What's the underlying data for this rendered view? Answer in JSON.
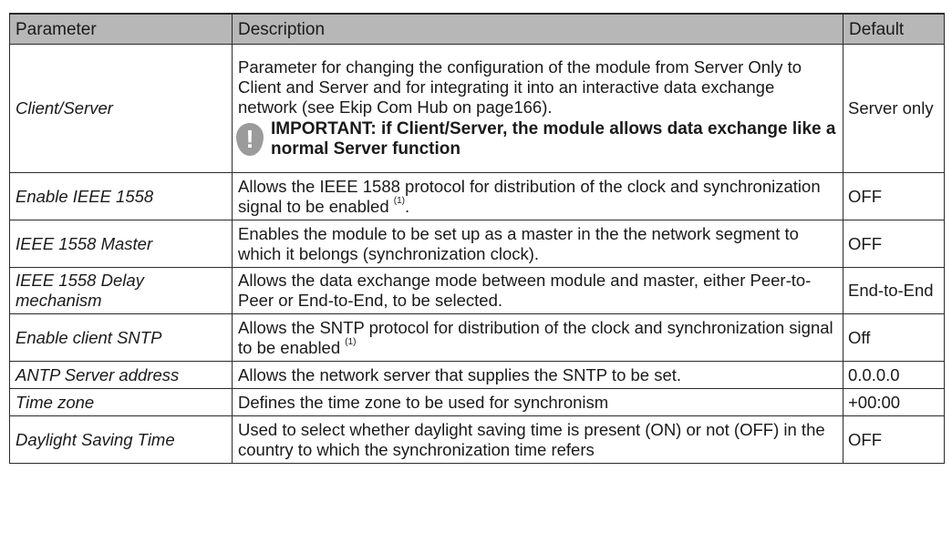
{
  "table": {
    "headers": [
      "Parameter",
      "Description",
      "Default"
    ],
    "rows": [
      {
        "parameter": "Client/Server",
        "description": "Parameter for changing the configuration of the module from Server Only to Client and Server and for integrating it into an interactive data exchange network (see Ekip Com Hub on page166).",
        "important": "IMPORTANT: if Client/Server, the module allows data exchange like a normal Server function",
        "default": "Server only"
      },
      {
        "parameter": "Enable IEEE 1558",
        "description": "Allows the IEEE 1588 protocol for distribution of the clock and synchronization signal to be enabled",
        "footnote": "(1)",
        "trail": ".",
        "default": "OFF"
      },
      {
        "parameter": "IEEE 1558 Master",
        "description": "Enables the module to be set up as a master in the the network segment to which it belongs (synchronization clock).",
        "default": "OFF"
      },
      {
        "parameter": "IEEE 1558 Delay mechanism",
        "description": "Allows the data exchange mode between module and master, either Peer-to-Peer or End-to-End, to be selected.",
        "default": "End-to-End"
      },
      {
        "parameter": "Enable client SNTP",
        "description": "Allows the SNTP protocol for distribution of the clock and synchronization signal to be enabled",
        "footnote": "(1)",
        "default": "Off"
      },
      {
        "parameter": "ANTP Server address",
        "description": "Allows the network server that supplies the SNTP to be set.",
        "default": "0.0.0.0"
      },
      {
        "parameter": "Time zone",
        "description": "Defines the time zone to be used for synchronism",
        "default": "+00:00"
      },
      {
        "parameter": "Daylight Saving Time",
        "description": "Used to select whether daylight saving time is present (ON) or not (OFF) in the country to which the synchronization time refers",
        "default": "OFF"
      }
    ]
  },
  "icons": {
    "important": "warning-exclamation-icon"
  },
  "colors": {
    "header_bg": "#b7b7b7",
    "icon": "#9b9b9b",
    "border": "#2b2b2b"
  }
}
